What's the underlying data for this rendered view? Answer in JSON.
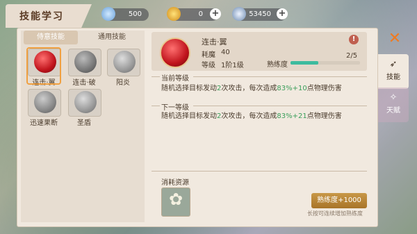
{
  "title": "技能学习",
  "resources": [
    {
      "icon": "diamond-icon",
      "value": "500"
    },
    {
      "icon": "gold-coin-icon",
      "value": "0"
    },
    {
      "icon": "silver-coin-icon",
      "value": "53450"
    }
  ],
  "subtabs": {
    "active": "侍意技能",
    "inactive": "通用技能"
  },
  "skills": [
    {
      "name": "连击·翼",
      "icon": "red-orb-icon",
      "selected": true
    },
    {
      "name": "连击·破",
      "icon": "gray-orb-icon",
      "selected": false
    },
    {
      "name": "阳炎",
      "icon": "gray-wing-icon",
      "selected": false
    },
    {
      "name": "迅速果断",
      "icon": "gray-wing-icon",
      "selected": false
    },
    {
      "name": "圣盾",
      "icon": "gray-shield-icon",
      "selected": false
    }
  ],
  "detail": {
    "name": "连击·翼",
    "cost_label": "耗魔",
    "cost_value": "40",
    "level_label": "等级",
    "level_value": "1阶1级",
    "proficiency_label": "熟练度",
    "proficiency_value": "2/5",
    "proficiency_fraction": 0.4
  },
  "current": {
    "title": "当前等级",
    "pre": "随机选择目标发动",
    "hits": "2",
    "mid": "次攻击，每次造成",
    "pct": "83%+10",
    "post": "点物理伤害"
  },
  "next": {
    "title": "下一等级",
    "pre": "随机选择目标发动",
    "hits": "2",
    "mid": "次攻击，每次造成",
    "pct": "83%+21",
    "post": "点物理伤害"
  },
  "consume": {
    "title": "消耗资源",
    "item_icon": "white-flower-icon",
    "button": "熟练度+1000",
    "hint": "长按可连续增加熟练度"
  },
  "side_tabs": [
    {
      "label": "技能",
      "icon": "skill-icon"
    },
    {
      "label": "天赋",
      "icon": "talent-icon"
    }
  ]
}
